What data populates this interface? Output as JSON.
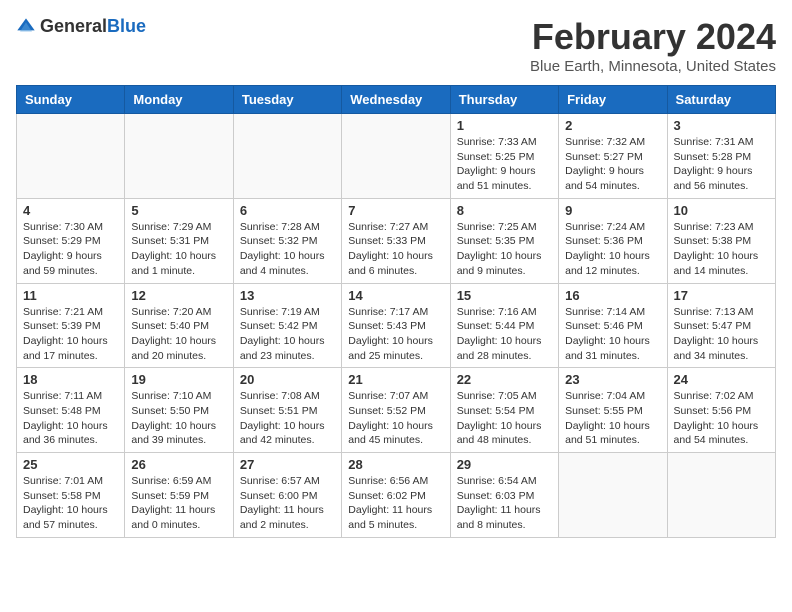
{
  "logo": {
    "text_general": "General",
    "text_blue": "Blue"
  },
  "header": {
    "month_year": "February 2024",
    "location": "Blue Earth, Minnesota, United States"
  },
  "weekdays": [
    "Sunday",
    "Monday",
    "Tuesday",
    "Wednesday",
    "Thursday",
    "Friday",
    "Saturday"
  ],
  "weeks": [
    [
      {
        "day": "",
        "info": ""
      },
      {
        "day": "",
        "info": ""
      },
      {
        "day": "",
        "info": ""
      },
      {
        "day": "",
        "info": ""
      },
      {
        "day": "1",
        "info": "Sunrise: 7:33 AM\nSunset: 5:25 PM\nDaylight: 9 hours and 51 minutes."
      },
      {
        "day": "2",
        "info": "Sunrise: 7:32 AM\nSunset: 5:27 PM\nDaylight: 9 hours and 54 minutes."
      },
      {
        "day": "3",
        "info": "Sunrise: 7:31 AM\nSunset: 5:28 PM\nDaylight: 9 hours and 56 minutes."
      }
    ],
    [
      {
        "day": "4",
        "info": "Sunrise: 7:30 AM\nSunset: 5:29 PM\nDaylight: 9 hours and 59 minutes."
      },
      {
        "day": "5",
        "info": "Sunrise: 7:29 AM\nSunset: 5:31 PM\nDaylight: 10 hours and 1 minute."
      },
      {
        "day": "6",
        "info": "Sunrise: 7:28 AM\nSunset: 5:32 PM\nDaylight: 10 hours and 4 minutes."
      },
      {
        "day": "7",
        "info": "Sunrise: 7:27 AM\nSunset: 5:33 PM\nDaylight: 10 hours and 6 minutes."
      },
      {
        "day": "8",
        "info": "Sunrise: 7:25 AM\nSunset: 5:35 PM\nDaylight: 10 hours and 9 minutes."
      },
      {
        "day": "9",
        "info": "Sunrise: 7:24 AM\nSunset: 5:36 PM\nDaylight: 10 hours and 12 minutes."
      },
      {
        "day": "10",
        "info": "Sunrise: 7:23 AM\nSunset: 5:38 PM\nDaylight: 10 hours and 14 minutes."
      }
    ],
    [
      {
        "day": "11",
        "info": "Sunrise: 7:21 AM\nSunset: 5:39 PM\nDaylight: 10 hours and 17 minutes."
      },
      {
        "day": "12",
        "info": "Sunrise: 7:20 AM\nSunset: 5:40 PM\nDaylight: 10 hours and 20 minutes."
      },
      {
        "day": "13",
        "info": "Sunrise: 7:19 AM\nSunset: 5:42 PM\nDaylight: 10 hours and 23 minutes."
      },
      {
        "day": "14",
        "info": "Sunrise: 7:17 AM\nSunset: 5:43 PM\nDaylight: 10 hours and 25 minutes."
      },
      {
        "day": "15",
        "info": "Sunrise: 7:16 AM\nSunset: 5:44 PM\nDaylight: 10 hours and 28 minutes."
      },
      {
        "day": "16",
        "info": "Sunrise: 7:14 AM\nSunset: 5:46 PM\nDaylight: 10 hours and 31 minutes."
      },
      {
        "day": "17",
        "info": "Sunrise: 7:13 AM\nSunset: 5:47 PM\nDaylight: 10 hours and 34 minutes."
      }
    ],
    [
      {
        "day": "18",
        "info": "Sunrise: 7:11 AM\nSunset: 5:48 PM\nDaylight: 10 hours and 36 minutes."
      },
      {
        "day": "19",
        "info": "Sunrise: 7:10 AM\nSunset: 5:50 PM\nDaylight: 10 hours and 39 minutes."
      },
      {
        "day": "20",
        "info": "Sunrise: 7:08 AM\nSunset: 5:51 PM\nDaylight: 10 hours and 42 minutes."
      },
      {
        "day": "21",
        "info": "Sunrise: 7:07 AM\nSunset: 5:52 PM\nDaylight: 10 hours and 45 minutes."
      },
      {
        "day": "22",
        "info": "Sunrise: 7:05 AM\nSunset: 5:54 PM\nDaylight: 10 hours and 48 minutes."
      },
      {
        "day": "23",
        "info": "Sunrise: 7:04 AM\nSunset: 5:55 PM\nDaylight: 10 hours and 51 minutes."
      },
      {
        "day": "24",
        "info": "Sunrise: 7:02 AM\nSunset: 5:56 PM\nDaylight: 10 hours and 54 minutes."
      }
    ],
    [
      {
        "day": "25",
        "info": "Sunrise: 7:01 AM\nSunset: 5:58 PM\nDaylight: 10 hours and 57 minutes."
      },
      {
        "day": "26",
        "info": "Sunrise: 6:59 AM\nSunset: 5:59 PM\nDaylight: 11 hours and 0 minutes."
      },
      {
        "day": "27",
        "info": "Sunrise: 6:57 AM\nSunset: 6:00 PM\nDaylight: 11 hours and 2 minutes."
      },
      {
        "day": "28",
        "info": "Sunrise: 6:56 AM\nSunset: 6:02 PM\nDaylight: 11 hours and 5 minutes."
      },
      {
        "day": "29",
        "info": "Sunrise: 6:54 AM\nSunset: 6:03 PM\nDaylight: 11 hours and 8 minutes."
      },
      {
        "day": "",
        "info": ""
      },
      {
        "day": "",
        "info": ""
      }
    ]
  ]
}
